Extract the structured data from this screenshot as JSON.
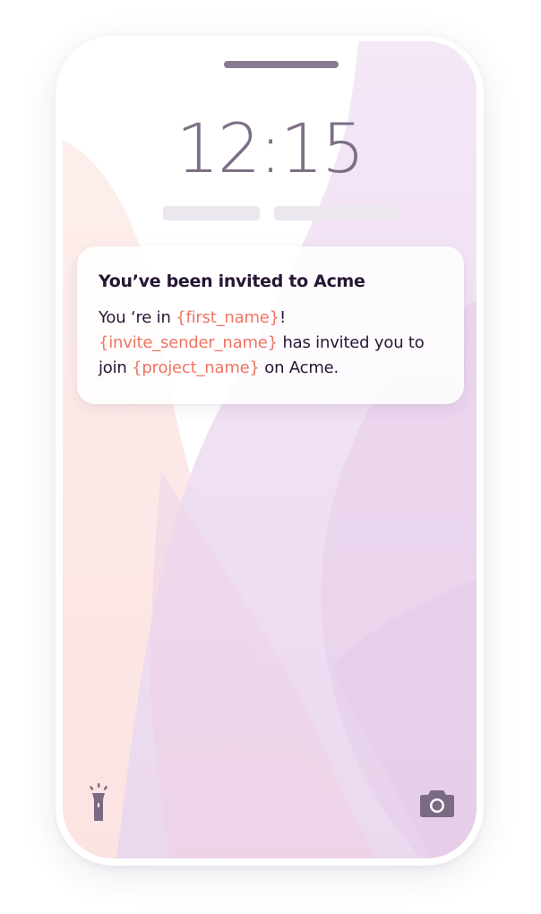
{
  "lockscreen": {
    "time": "12:15"
  },
  "notification": {
    "title": "You’ve been invited to Acme",
    "body": {
      "part1": "You ‘re in ",
      "var_first_name": "{first_name}",
      "part2": "!",
      "var_invite_sender": "{invite_sender_name}",
      "part3": " has invited you to join ",
      "var_project": "{project_name}",
      "part4": " on Acme."
    }
  },
  "icons": {
    "flashlight": "flashlight-icon",
    "camera": "camera-icon"
  },
  "colors": {
    "text_primary": "#271634",
    "variable_accent": "#f07463",
    "clock": "#7d6f86",
    "wallpaper_pink": "#fbe7e6",
    "wallpaper_lavender": "#ecd9f1"
  }
}
